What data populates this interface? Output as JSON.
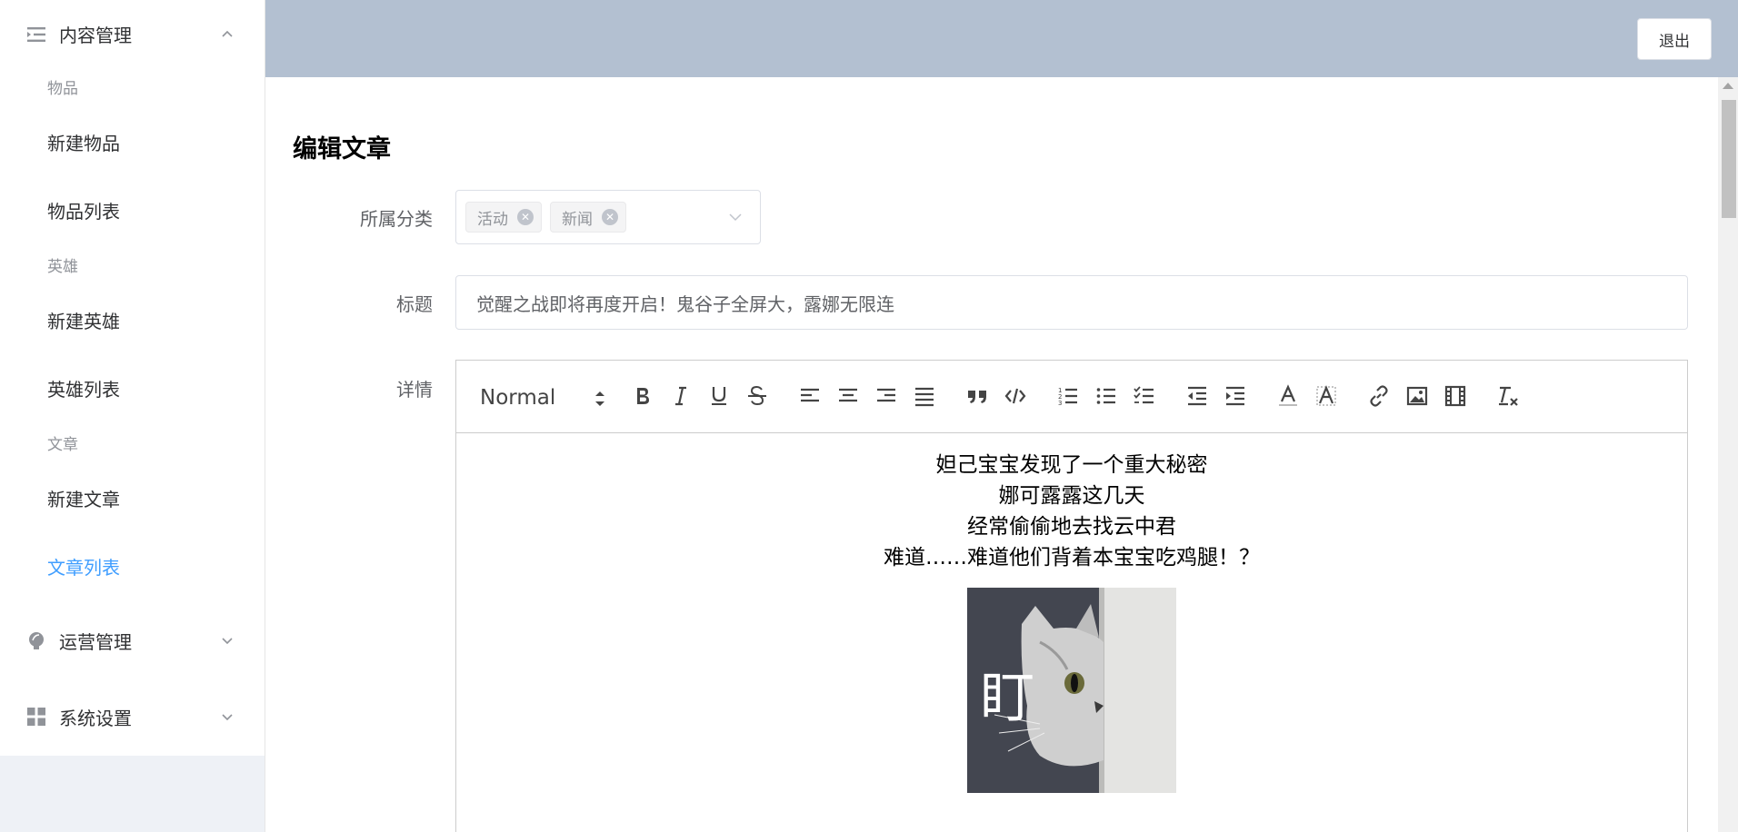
{
  "sidebar": {
    "content_mgmt": {
      "title": "内容管理",
      "icon": "list-indent-icon",
      "arrow": "chevron-up-icon"
    },
    "groups": [
      {
        "label": "物品",
        "items": [
          "新建物品",
          "物品列表"
        ]
      },
      {
        "label": "英雄",
        "items": [
          "新建英雄",
          "英雄列表"
        ]
      },
      {
        "label": "文章",
        "items": [
          "新建文章",
          "文章列表"
        ]
      }
    ],
    "active_item": "文章列表",
    "ops_mgmt": {
      "title": "运营管理",
      "icon": "lightbulb-icon"
    },
    "system_settings": {
      "title": "系统设置",
      "icon": "grid-icon"
    }
  },
  "header": {
    "logout_label": "退出",
    "bg_color": "#b3c0d1"
  },
  "page": {
    "title": "编辑文章",
    "category_label": "所属分类",
    "categories": [
      "活动",
      "新闻"
    ],
    "title_label": "标题",
    "title_value": "觉醒之战即将再度开启！鬼谷子全屏大，露娜无限连",
    "details_label": "详情"
  },
  "editor": {
    "header_format": "Normal",
    "toolbar": [
      "bold-icon",
      "italic-icon",
      "underline-icon",
      "strike-icon",
      "align-left-icon",
      "align-center-icon",
      "align-right-icon",
      "align-justify-icon",
      "blockquote-icon",
      "code-block-icon",
      "ordered-list-icon",
      "bullet-list-icon",
      "check-list-icon",
      "outdent-icon",
      "indent-icon",
      "text-color-icon",
      "background-color-icon",
      "link-icon",
      "image-icon",
      "video-icon",
      "clear-format-icon"
    ],
    "lines": [
      "妲己宝宝发现了一个重大秘密",
      "娜可露露这几天",
      "经常偷偷地去找云中君",
      "难道……难道他们背着本宝宝吃鸡腿！？"
    ],
    "image_caption": "盯"
  },
  "colors": {
    "accent": "#409eff"
  }
}
